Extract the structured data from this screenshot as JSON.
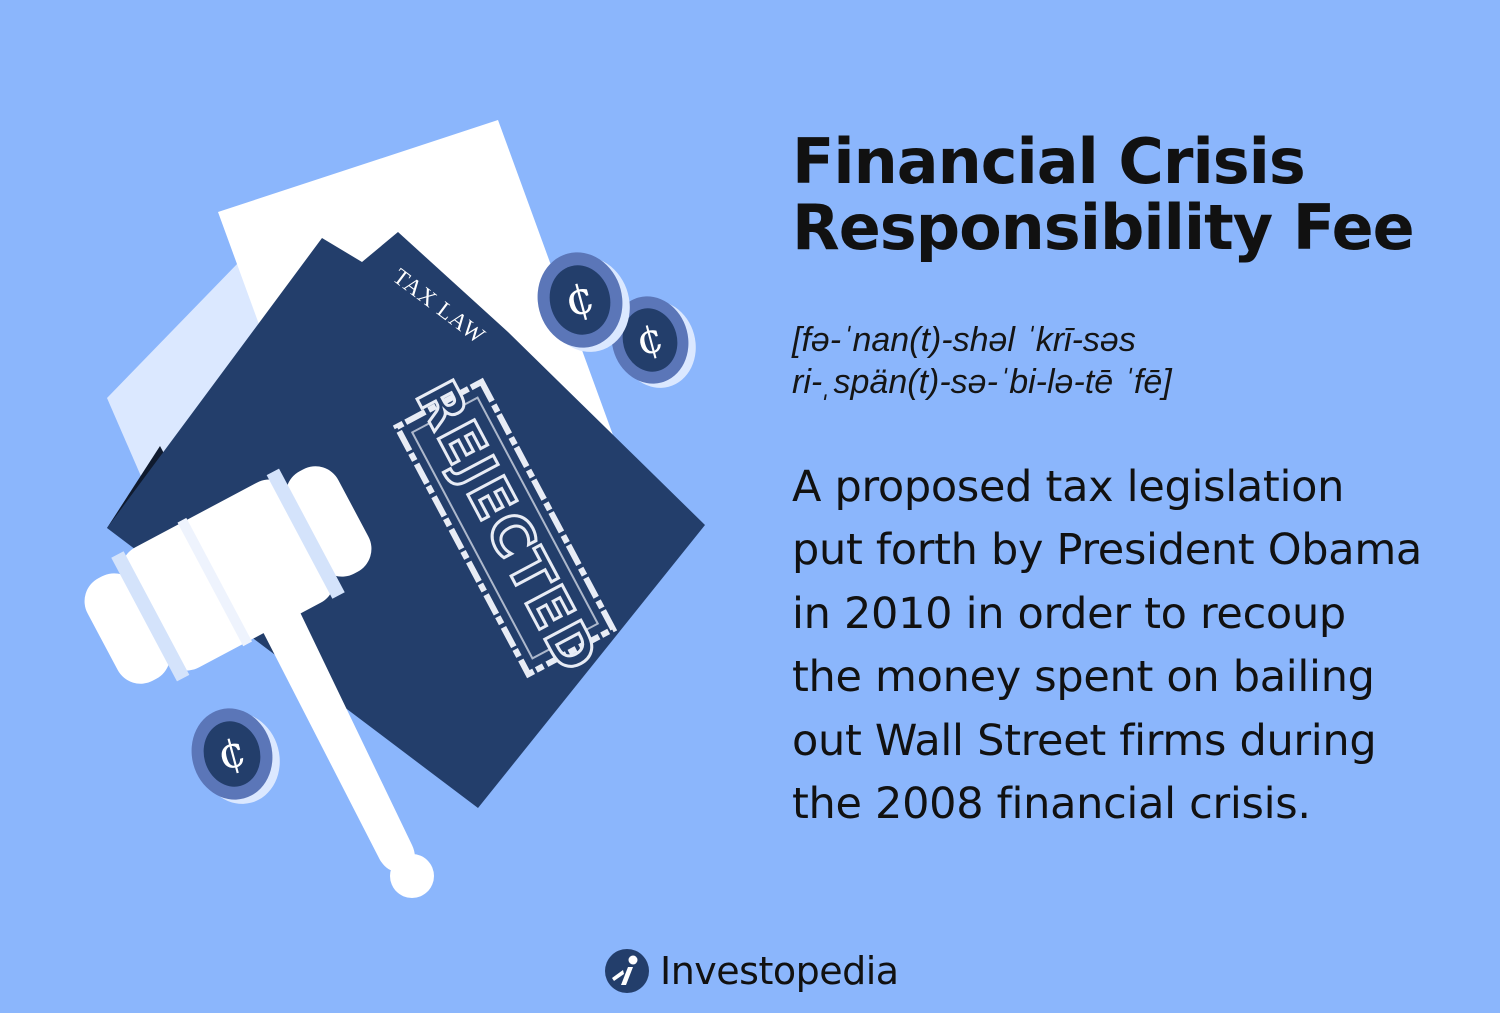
{
  "title": {
    "line1": "Financial Crisis",
    "line2": "Responsibility Fee"
  },
  "pronunciation": {
    "line1": "[fə-ˈnan(t)-shəl ˈkrī-səs",
    "line2": "ri-ˌspän(t)-sə-ˈbi-lə-tē ˈfē]"
  },
  "definition": {
    "lines": [
      "A proposed tax legislation",
      "put forth by President Obama",
      "in 2010 in order to recoup",
      "the money spent on bailing",
      "out Wall Street firms during",
      "the 2008 financial crisis."
    ]
  },
  "illustration": {
    "folder_tab_label": "TAX LAW",
    "stamp_text": "REJECTED",
    "coin_symbol": "¢"
  },
  "brand": {
    "name": "Investopedia",
    "logo_icon": "investopedia-logo-icon"
  },
  "colors": {
    "background": "#8bb6fc",
    "folder": "#233e6b",
    "coin": "#5b76b8",
    "gavel": "#ffffff",
    "text": "#111111"
  }
}
